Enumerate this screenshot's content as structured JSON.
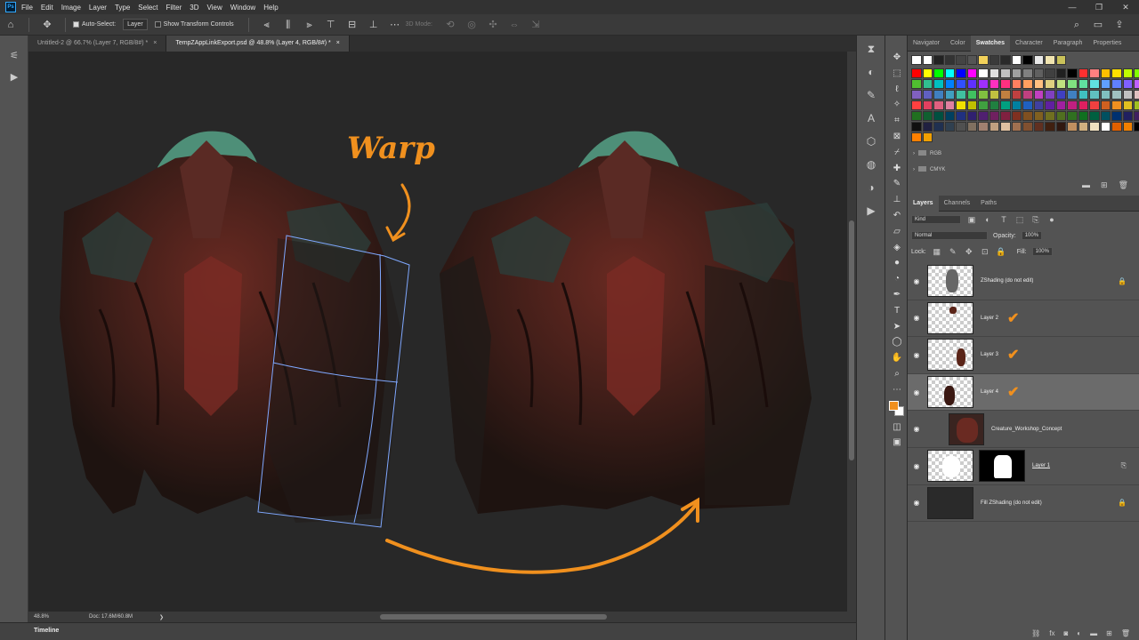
{
  "app": {
    "logo": "Ps"
  },
  "menu": [
    "File",
    "Edit",
    "Image",
    "Layer",
    "Type",
    "Select",
    "Filter",
    "3D",
    "View",
    "Window",
    "Help"
  ],
  "window_controls": [
    "—",
    "❐",
    "✕"
  ],
  "options": {
    "auto_select_label": "Auto-Select:",
    "auto_select_value": "Layer",
    "show_transform_label": "Show Transform Controls",
    "mode_3d_label": "3D Mode:"
  },
  "doc_tabs": [
    {
      "label": "Untitled-2 @ 66.7% (Layer 7, RGB/8#) *",
      "close": "×"
    },
    {
      "label": "TempZAppLinkExport.psd @ 48.8% (Layer 4, RGB/8#) *",
      "close": "×"
    }
  ],
  "canvas": {
    "annotation": "Warp",
    "colors": {
      "arrow": "#f0901e",
      "warp_grid": "#7fa8ff",
      "background": "#282828",
      "halo": "#4e8f78"
    }
  },
  "status": {
    "zoom": "48.8%",
    "doc": "Doc: 17.6M/60.8M",
    "arrow": "❯"
  },
  "timeline": {
    "label": "Timeline"
  },
  "panel_tabs_top": [
    {
      "label": "Navigator",
      "active": false
    },
    {
      "label": "Color",
      "active": false
    },
    {
      "label": "Swatches",
      "active": true
    },
    {
      "label": "Character",
      "active": false
    },
    {
      "label": "Paragraph",
      "active": false
    },
    {
      "label": "Properties",
      "active": false
    }
  ],
  "recent_swatches": [
    "#ffffff",
    "#ffffff",
    "#222222",
    "#333333",
    "#444444",
    "#555555",
    "#f2d15a",
    "#3a3a3a",
    "#2a2a2a",
    "#ffffff",
    "#000000",
    "#e8e8e8",
    "#f0e4b0",
    "#c9c15a"
  ],
  "swatches": [
    "#ff0000",
    "#ffff00",
    "#00ff00",
    "#00ffff",
    "#0000ff",
    "#ff00ff",
    "#ffffff",
    "#e0e0e0",
    "#c0c0c0",
    "#a0a0a0",
    "#808080",
    "#606060",
    "#404040",
    "#202020",
    "#000000",
    "#ff3030",
    "#ff8080",
    "#ffc000",
    "#ffe000",
    "#c0ff00",
    "#80ff00",
    "#50c030",
    "#30c090",
    "#00c0c0",
    "#0080ff",
    "#3050ff",
    "#6030ff",
    "#a030ff",
    "#ff30c0",
    "#ff3080",
    "#ff8060",
    "#ffa060",
    "#ffc080",
    "#e0d080",
    "#c0e080",
    "#80e080",
    "#60e0a0",
    "#60e0e0",
    "#60a0ff",
    "#6080ff",
    "#8060ff",
    "#c060ff",
    "#8060c0",
    "#6060c0",
    "#4080c0",
    "#40a0c0",
    "#40c0a0",
    "#40c060",
    "#80c040",
    "#c0c040",
    "#c08040",
    "#c04040",
    "#c04080",
    "#c040c0",
    "#8040c0",
    "#4040c0",
    "#4080c0",
    "#40c0c0",
    "#60c0c0",
    "#80c0c0",
    "#a0c0c0",
    "#c0c0c0",
    "#e0c0c0",
    "#ff4040",
    "#e04060",
    "#e06080",
    "#e080a0",
    "#f0e000",
    "#c0c000",
    "#40a040",
    "#208040",
    "#00a080",
    "#0080a0",
    "#2060c0",
    "#4040a0",
    "#6020a0",
    "#a020a0",
    "#c02080",
    "#e02060",
    "#f04040",
    "#d06020",
    "#f09020",
    "#e0c020",
    "#a0c020",
    "#207020",
    "#106030",
    "#005040",
    "#004060",
    "#203080",
    "#302070",
    "#502070",
    "#702060",
    "#802040",
    "#803020",
    "#805020",
    "#806020",
    "#707020",
    "#507020",
    "#307020",
    "#107020",
    "#006040",
    "#005060",
    "#003070",
    "#202060",
    "#402060",
    "#101010",
    "#202040",
    "#203050",
    "#304050",
    "#505050",
    "#807060",
    "#a08070",
    "#c0a080",
    "#e0c0a0",
    "#a07050",
    "#805030",
    "#603020",
    "#402010",
    "#301810",
    "#c09060",
    "#d0b080",
    "#f0e0c0",
    "#ffffff",
    "#e06000",
    "#f08000",
    "#000000",
    "#ff8000",
    "#f0a000"
  ],
  "swatch_folders": [
    {
      "label": "RGB"
    },
    {
      "label": "CMYK"
    }
  ],
  "panel_tabs_layers": [
    {
      "label": "Layers",
      "active": true
    },
    {
      "label": "Channels",
      "active": false
    },
    {
      "label": "Paths",
      "active": false
    }
  ],
  "layers_controls": {
    "kind": "Kind",
    "blend_mode": "Normal",
    "opacity_label": "Opacity:",
    "opacity_value": "100%",
    "lock_label": "Lock:",
    "fill_label": "Fill:",
    "fill_value": "100%"
  },
  "layers": [
    {
      "name": "ZShading (do not edit)",
      "visible": true,
      "locked": true,
      "checked": false,
      "active": false
    },
    {
      "name": "Layer 2",
      "visible": true,
      "locked": false,
      "checked": true,
      "active": false
    },
    {
      "name": "Layer 3",
      "visible": true,
      "locked": false,
      "checked": true,
      "active": false
    },
    {
      "name": "Layer 4",
      "visible": true,
      "locked": false,
      "checked": true,
      "active": true
    },
    {
      "name": "Creature_Workshop_Concept",
      "visible": true,
      "locked": false,
      "checked": false,
      "active": false
    },
    {
      "name": "Layer 1",
      "visible": true,
      "locked": false,
      "checked": false,
      "active": false
    },
    {
      "name": "Fill ZShading (do not edit)",
      "visible": true,
      "locked": true,
      "checked": false,
      "active": false
    }
  ],
  "glyphs": {
    "check": "✔",
    "eye": "◉",
    "lock": "🔒"
  }
}
